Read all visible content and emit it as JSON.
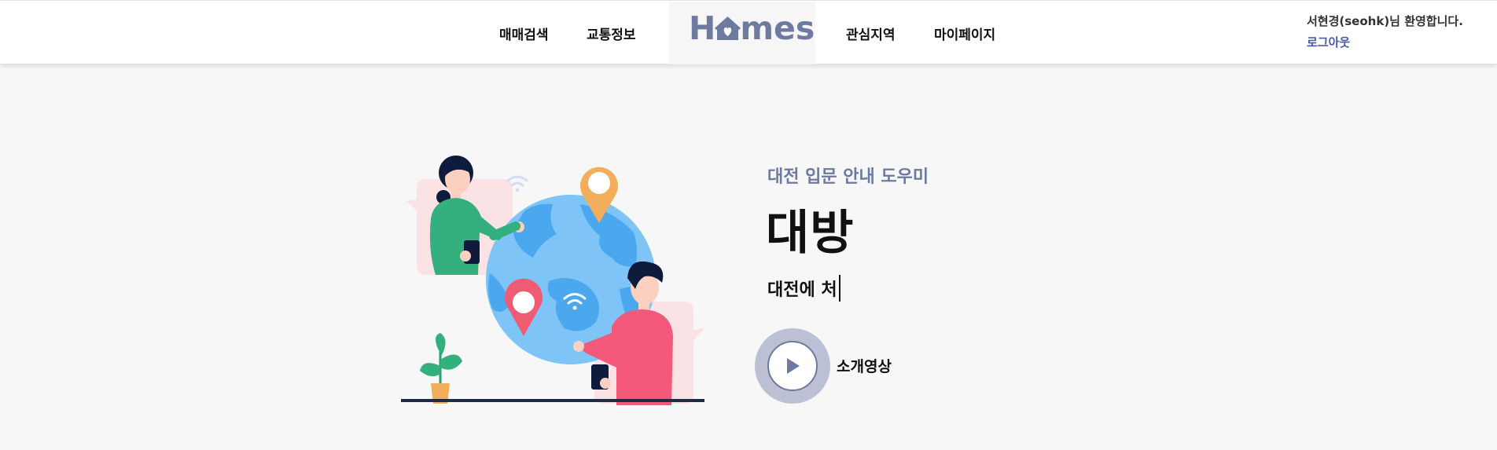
{
  "header": {
    "nav_left": [
      "매매검색",
      "교통정보"
    ],
    "nav_right": [
      "관심지역",
      "마이페이지"
    ],
    "logo": {
      "before": "H",
      "after": "mes",
      "icon": "house-icon",
      "color": "#6f7aa0"
    },
    "welcome": "서현경(seohk)님 환영합니다.",
    "logout": "로그아웃"
  },
  "hero": {
    "subtitle": "대전 입문 안내 도우미",
    "title": "대방",
    "typing_text": "대전에 처",
    "video_label": "소개영상",
    "play_icon": "play-icon",
    "accent_color": "#6d79a0"
  }
}
